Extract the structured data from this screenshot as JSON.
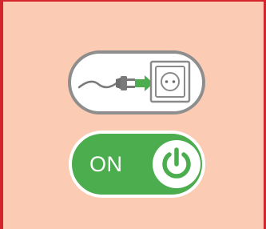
{
  "toggle": {
    "label": "ON",
    "state": "on",
    "color": "#4cad4f"
  },
  "plug_indicator": {
    "icon": "plug-into-socket-icon",
    "arrow_color": "#4cad4f"
  },
  "icons": {
    "toggle_knob": "power-icon"
  },
  "colors": {
    "background": "#fbcbb4",
    "frame_border": "#d4242c",
    "pill_border": "#8e8e8e"
  }
}
